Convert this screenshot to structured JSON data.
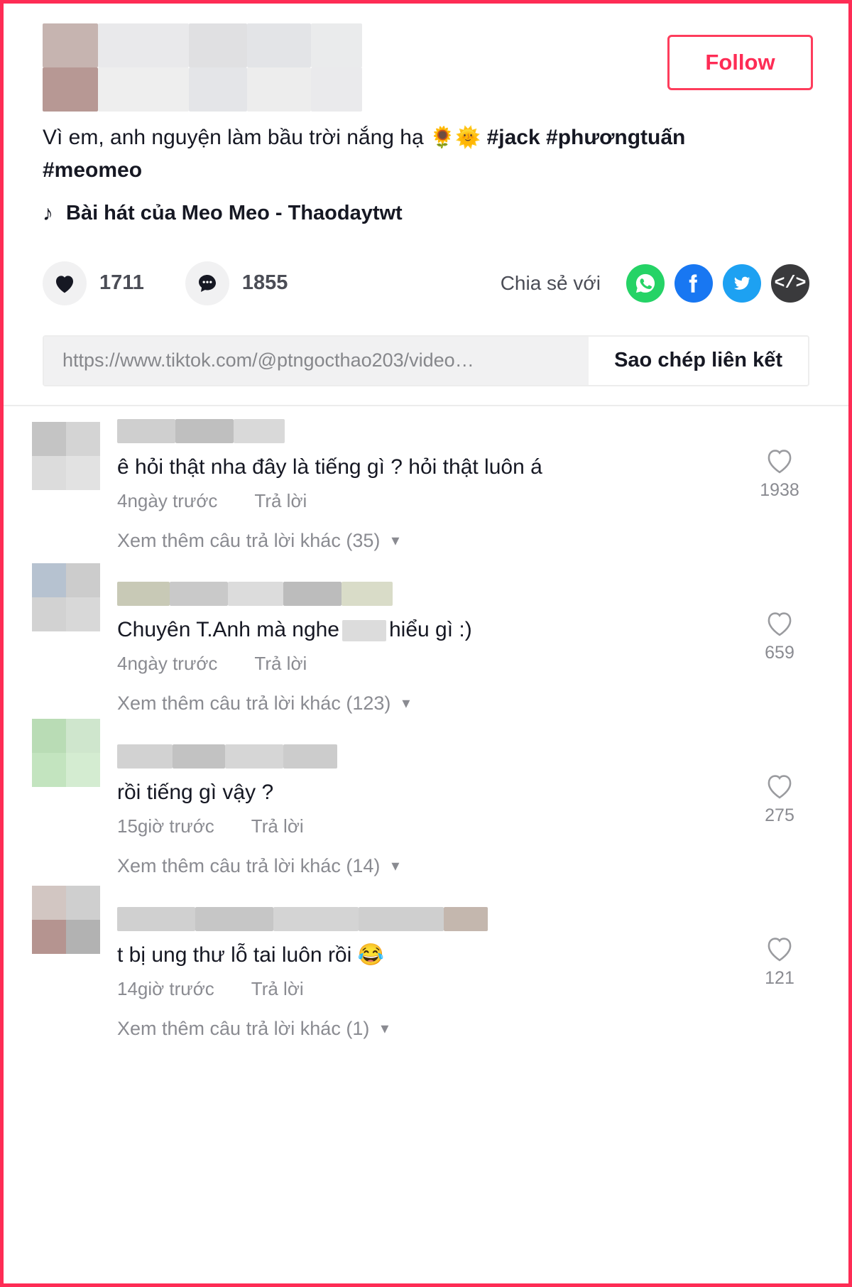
{
  "window": {
    "accent_color": "#fe2c55",
    "border_color": "#fe2c55"
  },
  "video": {
    "follow_label": "Follow",
    "caption_line1": "Vì em, anh nguyện làm bầu trời nắng hạ",
    "caption_emoji": "🌻🌞",
    "caption_tag1": "#jack",
    "caption_tag2": "#phươngtuấn",
    "caption_tag3": "#meomeo",
    "music_icon": "music-note-icon",
    "music_title": "Bài hát của Meo Meo - Thaodaytwt",
    "like_icon": "heart-icon",
    "like_count": "1711",
    "comment_icon": "comment-bubble-icon",
    "comment_count": "1855",
    "share_label": "Chia sẻ với",
    "share_targets": [
      {
        "name": "whatsapp-icon",
        "color": "#25D366"
      },
      {
        "name": "facebook-icon",
        "color": "#1877F2"
      },
      {
        "name": "twitter-icon",
        "color": "#1DA1F2"
      },
      {
        "name": "embed-code-icon",
        "color": "#3a3a3c",
        "glyph": "</>"
      }
    ],
    "link_url": "https://www.tiktok.com/@ptngocthao203/video…",
    "copy_link_label": "Sao chép liên kết"
  },
  "comments": [
    {
      "text": "ê hỏi thật nha đây là tiếng gì ? hỏi thật luôn á",
      "time": "4ngày trước",
      "reply_label": "Trả lời",
      "like_count": "1938",
      "view_more_label": "Xem thêm câu trả lời khác (35)",
      "avatar_colors": [
        "#c4c4c4",
        "#d4d4d4",
        "#dcdcdc",
        "#e2e2e2"
      ],
      "name_blur_colors": [
        "#cfcfcf",
        "#bfbfbf",
        "#d9d9d9"
      ]
    },
    {
      "text_before": "Chuyên T.Anh mà nghe",
      "text_after": "hiểu gì :)",
      "time": "4ngày trước",
      "reply_label": "Trả lời",
      "like_count": "659",
      "view_more_label": "Xem thêm câu trả lời khác (123)",
      "avatar_colors": [
        "#b6c2d0",
        "#cccccc",
        "#d2d2d2",
        "#d8d8d8"
      ],
      "name_blur_colors": [
        "#c8c9b6",
        "#c9c9c9",
        "#dcdcdc",
        "#bcbcbc",
        "#d9dcc8"
      ]
    },
    {
      "text": "rồi tiếng gì vậy ?",
      "time": "15giờ trước",
      "reply_label": "Trả lời",
      "like_count": "275",
      "view_more_label": "Xem thêm câu trả lời khác (14)",
      "avatar_colors": [
        "#b9dcb5",
        "#cfe6cd",
        "#c3e4bf",
        "#d4ecd1"
      ],
      "name_blur_colors": [
        "#d2d2d2",
        "#c2c2c2",
        "#d6d6d6",
        "#cccccc"
      ]
    },
    {
      "text": "t bị ung thư lỗ tai luôn rồi 😂",
      "time": "14giờ trước",
      "reply_label": "Trả lời",
      "like_count": "121",
      "view_more_label": "Xem thêm câu trả lời khác (1)",
      "avatar_colors": [
        "#d2c6c2",
        "#cfcfcf",
        "#b59490",
        "#b2b2b2"
      ],
      "name_blur_colors": [
        "#d0d0d0",
        "#c6c6c6",
        "#d4d4d4",
        "#cfcfcf",
        "#c4b7ae"
      ]
    }
  ]
}
